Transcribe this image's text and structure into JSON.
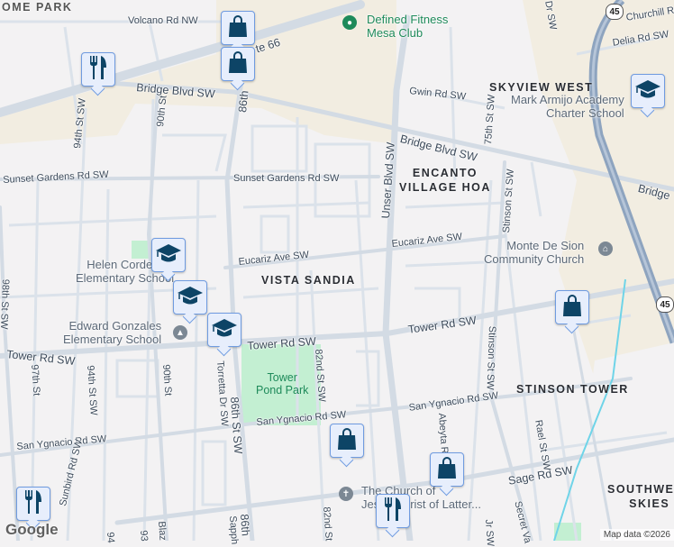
{
  "colors": {
    "background": "#f3f2f3",
    "road": "#d5dde5",
    "highway": "#8ea4bf",
    "park": "#c3efd2",
    "tan": "#f2ede1",
    "marker_icon": "#0d4466",
    "water": "#6fd4e8"
  },
  "roads": {
    "volcano": "Volcano Rd NW",
    "rt66": "te 66",
    "bridge1": "Bridge Blvd SW",
    "bridge2": "Bridge Blvd SW",
    "bridge3": "Bridge",
    "sunset1": "Sunset Gardens Rd SW",
    "sunset2": "Sunset Gardens Rd SW",
    "eucariz1": "Eucariz Ave SW",
    "eucariz2": "Eucariz Ave SW",
    "tower1": "Tower Rd SW",
    "tower2": "Tower Rd SW",
    "tower3": "Tower Rd SW",
    "sanyg1": "San Ygnacio Rd SW",
    "sanyg2": "San Ygnacio Rd SW",
    "sanyg3": "San Ygnacio Rd SW",
    "sage": "Sage Rd SW",
    "unser": "Unser Blvd SW",
    "st86a": "86th",
    "st86b": "86th St SW",
    "st86c": "86th",
    "st90a": "90th St",
    "st90b": "90th St",
    "st94a": "94th St SW",
    "st94b": "94th St SW",
    "st98": "98th St SW",
    "st97": "97th St",
    "toretta": "Torretta Dr SW",
    "st82a": "82nd St SW",
    "st82b": "82nd St",
    "st75": "75th St SW",
    "stinson1": "Stinson St SW",
    "stinson2": "Stinson St SW",
    "gwin": "Gwin Rd SW",
    "delia": "Delia Rd SW",
    "churchill": "Churchill Rd",
    "dr": "Dr SW",
    "abeyta": "Abeyta R",
    "rael": "Rael St SW",
    "sunbird": "Sunbird Rd SW",
    "secret": "Secret Va",
    "blaz": "Blaz",
    "sapph": "Sapph",
    "st93": "93",
    "st94c": "94",
    "jr": "Jr SW",
    "i25": "45"
  },
  "neighborhoods": {
    "skyview": "SKYVIEW WEST",
    "encanto": "ENCANTO\nVILLAGE HOA",
    "vista": "VISTA SANDIA",
    "stinson": "STINSON TOWER",
    "southwest": "SOUTHWEST\nSKIES",
    "top": "OME PARK"
  },
  "pois": {
    "fitness": "Defined Fitness\nMesa Club",
    "armijo": "Mark Armijo Academy\nCharter School",
    "helen": "Helen Cordero\nElementary School",
    "edward": "Edward Gonzales\nElementary School",
    "monte": "Monte De Sion\nCommunity Church",
    "church": "The Church of\nJesus Christ of Latter...",
    "park": "Tower\nPond Park"
  },
  "markers": [
    {
      "type": "shopping",
      "icon": "shopping-bag-icon"
    },
    {
      "type": "shopping",
      "icon": "shopping-bag-icon"
    },
    {
      "type": "shopping",
      "icon": "shopping-bag-icon"
    },
    {
      "type": "shopping",
      "icon": "shopping-bag-icon"
    },
    {
      "type": "shopping",
      "icon": "shopping-bag-icon"
    },
    {
      "type": "restaurant",
      "icon": "fork-knife-icon"
    },
    {
      "type": "restaurant",
      "icon": "fork-knife-icon"
    },
    {
      "type": "restaurant",
      "icon": "fork-knife-icon"
    },
    {
      "type": "school",
      "icon": "graduation-cap-icon"
    },
    {
      "type": "school",
      "icon": "graduation-cap-icon"
    },
    {
      "type": "school",
      "icon": "graduation-cap-icon"
    },
    {
      "type": "school",
      "icon": "graduation-cap-icon"
    }
  ],
  "footer": {
    "google": "Google",
    "attribution": "Map data ©2026"
  }
}
